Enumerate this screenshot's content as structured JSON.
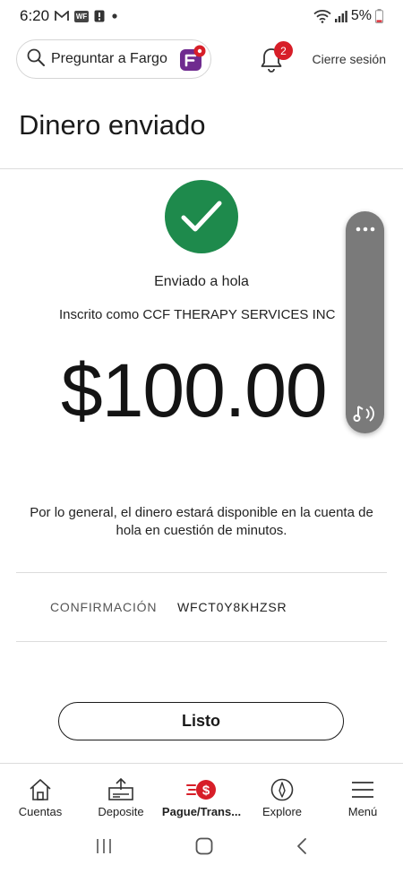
{
  "status_bar": {
    "time": "6:20",
    "battery": "5%",
    "wf_badge": "WF",
    "icons": [
      "gmail-icon",
      "wells-fargo-notification-icon",
      "alert-icon",
      "dot-icon",
      "wifi-icon",
      "signal-icon",
      "battery-icon"
    ]
  },
  "header": {
    "search_label": "Preguntar a Fargo",
    "notification_count": "2",
    "logout_label": "Cierre sesión"
  },
  "page": {
    "title": "Dinero enviado",
    "sent_to": "Enviado a hola",
    "enrolled_as": "Inscrito como CCF THERAPY SERVICES INC",
    "amount": "$100.00",
    "availability_message": "Por lo general, el dinero estará disponible en la cuenta de hola en cuestión de minutos.",
    "confirmation_label": "CONFIRMACIÓN",
    "confirmation_number": "WFCT0Y8KHZSR",
    "done_button": "Listo"
  },
  "bottom_nav": {
    "items": [
      {
        "label": "Cuentas",
        "icon": "home-icon"
      },
      {
        "label": "Deposite",
        "icon": "deposit-icon"
      },
      {
        "label": "Pague/Trans...",
        "icon": "pay-transfer-icon"
      },
      {
        "label": "Explore",
        "icon": "compass-icon"
      },
      {
        "label": "Menú",
        "icon": "hamburger-icon"
      }
    ],
    "active_index": 2
  },
  "system_nav": {
    "icons": [
      "recent-apps-icon",
      "home-button-icon",
      "back-icon"
    ]
  },
  "colors": {
    "success_green": "#1e8a4c",
    "brand_red": "#d71e28",
    "fargo_purple": "#6f2b8f"
  }
}
